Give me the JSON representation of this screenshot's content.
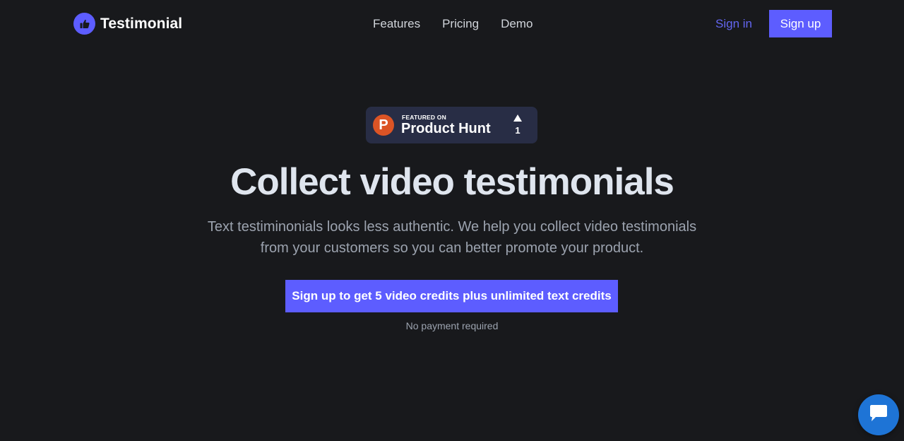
{
  "brand": {
    "name": "Testimonial",
    "accent": "#5d5dff"
  },
  "nav": {
    "links": [
      "Features",
      "Pricing",
      "Demo"
    ],
    "sign_in": "Sign in",
    "sign_up": "Sign up"
  },
  "product_hunt": {
    "featured_label": "FEATURED ON",
    "name": "Product Hunt",
    "upvotes": "1",
    "logo_letter": "P"
  },
  "hero": {
    "headline": "Collect video testimonials",
    "subtext_line1": "Text testiminonials looks less authentic. We help you collect video testimonials",
    "subtext_line2": "from your customers so you can better promote your product.",
    "cta": "Sign up to get 5 video credits plus unlimited text credits",
    "note": "No payment required"
  },
  "chat_widget": {
    "icon": "chat-bubble-icon",
    "color": "#1e74d6"
  }
}
